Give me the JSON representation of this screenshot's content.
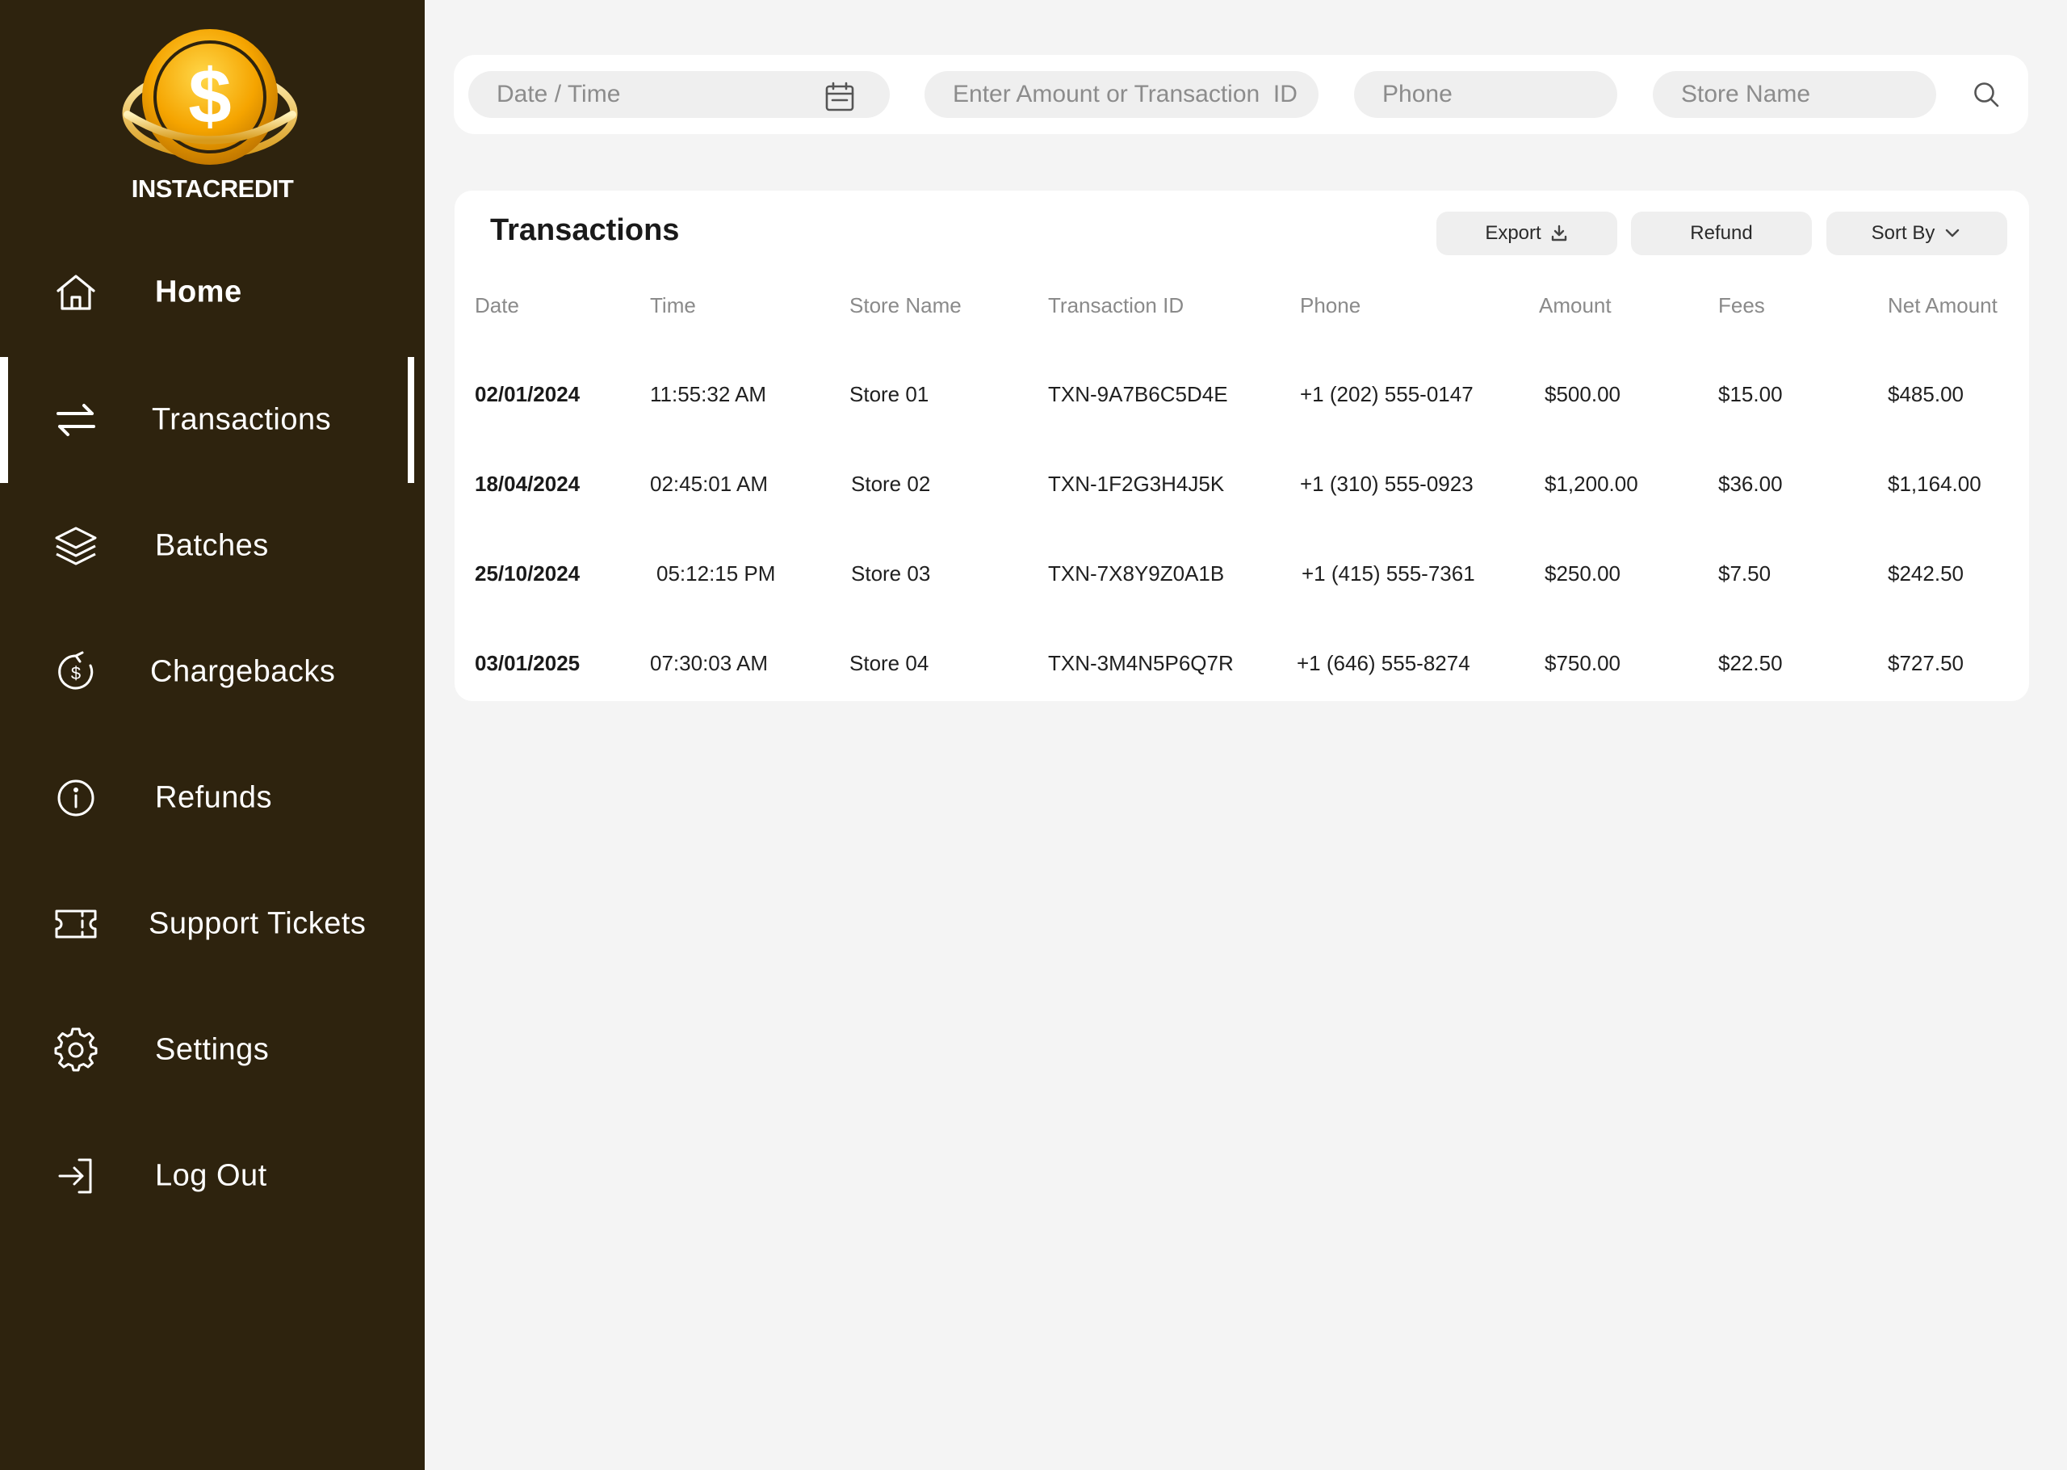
{
  "brand": {
    "name": "INSTACREDIT",
    "logo_symbol": "$",
    "gold": "#f5a400",
    "sidebar_bg": "#2e230e"
  },
  "nav": [
    {
      "label": "Home",
      "icon": "home-icon"
    },
    {
      "label": "Transactions",
      "icon": "arrows-exchange-icon",
      "active": true
    },
    {
      "label": "Batches",
      "icon": "layers-icon"
    },
    {
      "label": "Chargebacks",
      "icon": "dollar-refresh-icon"
    },
    {
      "label": "Refunds",
      "icon": "info-circle-icon"
    },
    {
      "label": "Support Tickets",
      "icon": "ticket-icon"
    },
    {
      "label": "Settings",
      "icon": "gear-icon"
    },
    {
      "label": "Log Out",
      "icon": "logout-icon"
    }
  ],
  "search": {
    "date_placeholder": "Date / Time",
    "amount_placeholder": "Enter Amount or Transaction  ID",
    "phone_placeholder": "Phone",
    "store_placeholder": "Store Name"
  },
  "transactions": {
    "title": "Transactions",
    "export_label": "Export",
    "refund_label": "Refund",
    "sort_label": "Sort By",
    "columns": [
      "Date",
      "Time",
      "Store Name",
      "Transaction ID",
      "Phone",
      "Amount",
      "Fees",
      "Net Amount"
    ],
    "rows": [
      [
        "02/01/2024",
        "11:55:32 AM",
        "Store 01",
        "TXN-9A7B6C5D4E",
        "+1 (202) 555-0147",
        "$500.00",
        "$15.00",
        "$485.00"
      ],
      [
        "18/04/2024",
        "02:45:01 AM",
        "Store 02",
        "TXN-1F2G3H4J5K",
        "+1 (310) 555-0923",
        "$1,200.00",
        "$36.00",
        "$1,164.00"
      ],
      [
        "25/10/2024",
        "05:12:15 PM",
        "Store 03",
        "TXN-7X8Y9Z0A1B",
        "+1 (415) 555-7361",
        "$250.00",
        "$7.50",
        "$242.50"
      ],
      [
        "03/01/2025",
        "07:30:03 AM",
        "Store 04",
        "TXN-3M4N5P6Q7R",
        "+1 (646) 555-8274",
        "$750.00",
        "$22.50",
        "$727.50"
      ]
    ]
  }
}
